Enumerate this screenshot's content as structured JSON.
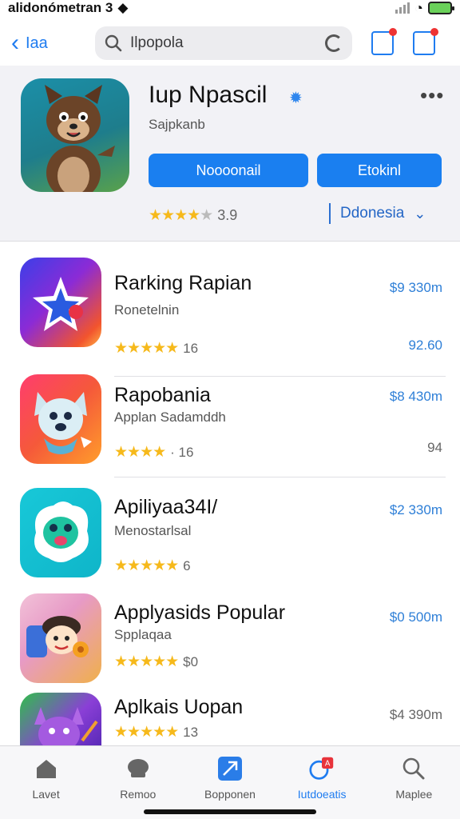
{
  "status_bar": {
    "carrier": "alidonómetran 3"
  },
  "top_bar": {
    "back_label": "Iaa",
    "search_placeholder": "Ilpopola"
  },
  "hero": {
    "title": "Iup Npascil",
    "subtitle": "Sajpkanb",
    "primary_button": "Noooonail",
    "secondary_button": "Etokinl",
    "rating": "3.9",
    "region": "Ddonesia"
  },
  "apps": [
    {
      "title": "Rarking Rapian",
      "subtitle": "Ronetelnin",
      "reviews": "16",
      "price": "$9 330m",
      "size": "92.60",
      "size_grey": false,
      "stars": 5
    },
    {
      "title": "Rapobania",
      "subtitle": "Applan Sadamddh",
      "reviews": "· 16",
      "price": "$8 430m",
      "size": "94",
      "size_grey": true,
      "stars": 4
    },
    {
      "title": "Apiliyaa34I/",
      "subtitle": "Menostarlsal",
      "reviews": "6",
      "price": "$2 330m",
      "size": "",
      "size_grey": false,
      "stars": 5
    },
    {
      "title": "Applyasids Popular",
      "subtitle": "Spplaqaa",
      "reviews": "$0",
      "price": "$0 500m",
      "size": "",
      "size_grey": false,
      "stars": 5
    },
    {
      "title": "Aplkais Uopan",
      "subtitle": "",
      "reviews": "13",
      "price": "$4 390m",
      "size": "",
      "size_grey": true,
      "stars": 5
    }
  ],
  "tabs": [
    {
      "label": "Lavet",
      "icon": "home-icon",
      "active": false
    },
    {
      "label": "Remoo",
      "icon": "games-icon",
      "active": false
    },
    {
      "label": "Bopponen",
      "icon": "apps-icon",
      "active": false
    },
    {
      "label": "Iutdoeatis",
      "icon": "updates-icon",
      "active": true
    },
    {
      "label": "Maplee",
      "icon": "search-icon",
      "active": false
    }
  ],
  "colors": {
    "accent": "#1a7ff0",
    "star": "#f6b91b",
    "price": "#2e7fd7"
  }
}
